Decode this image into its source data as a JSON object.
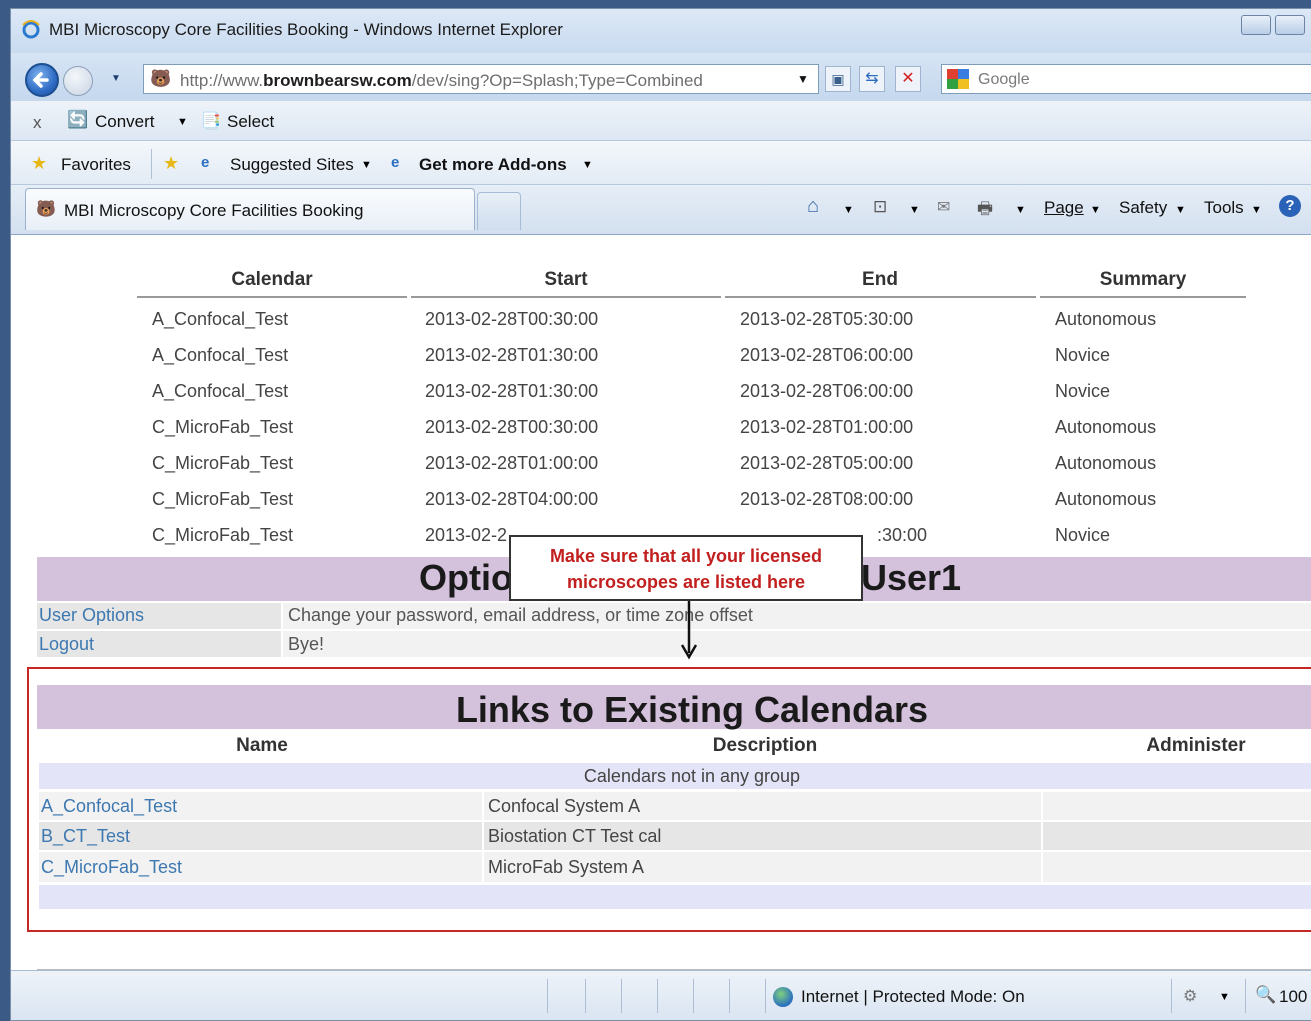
{
  "window": {
    "title": "MBI Microscopy Core Facilities Booking - Windows Internet Explorer"
  },
  "address": {
    "url_prefix": "http://www.",
    "url_domain": "brownbearsw.com",
    "url_path": "/dev/sing?Op=Splash;Type=Combined",
    "search_placeholder": "Google"
  },
  "toolbar": {
    "close": "x",
    "convert": "Convert",
    "select": "Select"
  },
  "favorites": {
    "favorites": "Favorites",
    "suggested_sites": "Suggested Sites",
    "get_addons": "Get more Add-ons"
  },
  "tab": {
    "title": "MBI Microscopy Core Facilities Booking"
  },
  "command_bar": {
    "page": "Page",
    "safety": "Safety",
    "tools": "Tools"
  },
  "events": {
    "headers": [
      "Calendar",
      "Start",
      "End",
      "Summary"
    ],
    "rows": [
      {
        "calendar": "A_Confocal_Test",
        "start": "2013-02-28T00:30:00",
        "end": "2013-02-28T05:30:00",
        "summary": "Autonomous"
      },
      {
        "calendar": "A_Confocal_Test",
        "start": "2013-02-28T01:30:00",
        "end": "2013-02-28T06:00:00",
        "summary": "Novice"
      },
      {
        "calendar": "A_Confocal_Test",
        "start": "2013-02-28T01:30:00",
        "end": "2013-02-28T06:00:00",
        "summary": "Novice"
      },
      {
        "calendar": "C_MicroFab_Test",
        "start": "2013-02-28T00:30:00",
        "end": "2013-02-28T01:00:00",
        "summary": "Autonomous"
      },
      {
        "calendar": "C_MicroFab_Test",
        "start": "2013-02-28T01:00:00",
        "end": "2013-02-28T05:00:00",
        "summary": "Autonomous"
      },
      {
        "calendar": "C_MicroFab_Test",
        "start": "2013-02-28T04:00:00",
        "end": "2013-02-28T08:00:00",
        "summary": "Autonomous"
      },
      {
        "calendar": "C_MicroFab_Test",
        "start": "2013-02-2",
        "end": ":30:00",
        "summary": "Novice"
      }
    ]
  },
  "options": {
    "title_left": "Optio",
    "title_right": "User1",
    "rows": [
      {
        "label": "User Options",
        "desc": "Change your password, email address, or time zone offset"
      },
      {
        "label": "Logout",
        "desc": "Bye!"
      }
    ]
  },
  "callout": {
    "line1": "Make sure that all your licensed",
    "line2": "microscopes are listed here"
  },
  "calendars": {
    "title": "Links to Existing Calendars",
    "headers": [
      "Name",
      "Description",
      "Administer"
    ],
    "group": "Calendars not in any group",
    "rows": [
      {
        "name": "A_Confocal_Test",
        "desc": "Confocal System A"
      },
      {
        "name": "B_CT_Test",
        "desc": "Biostation CT Test cal"
      },
      {
        "name": "C_MicroFab_Test",
        "desc": "MicroFab System A"
      }
    ]
  },
  "status": {
    "zone": "Internet | Protected Mode: On",
    "zoom": "100"
  }
}
